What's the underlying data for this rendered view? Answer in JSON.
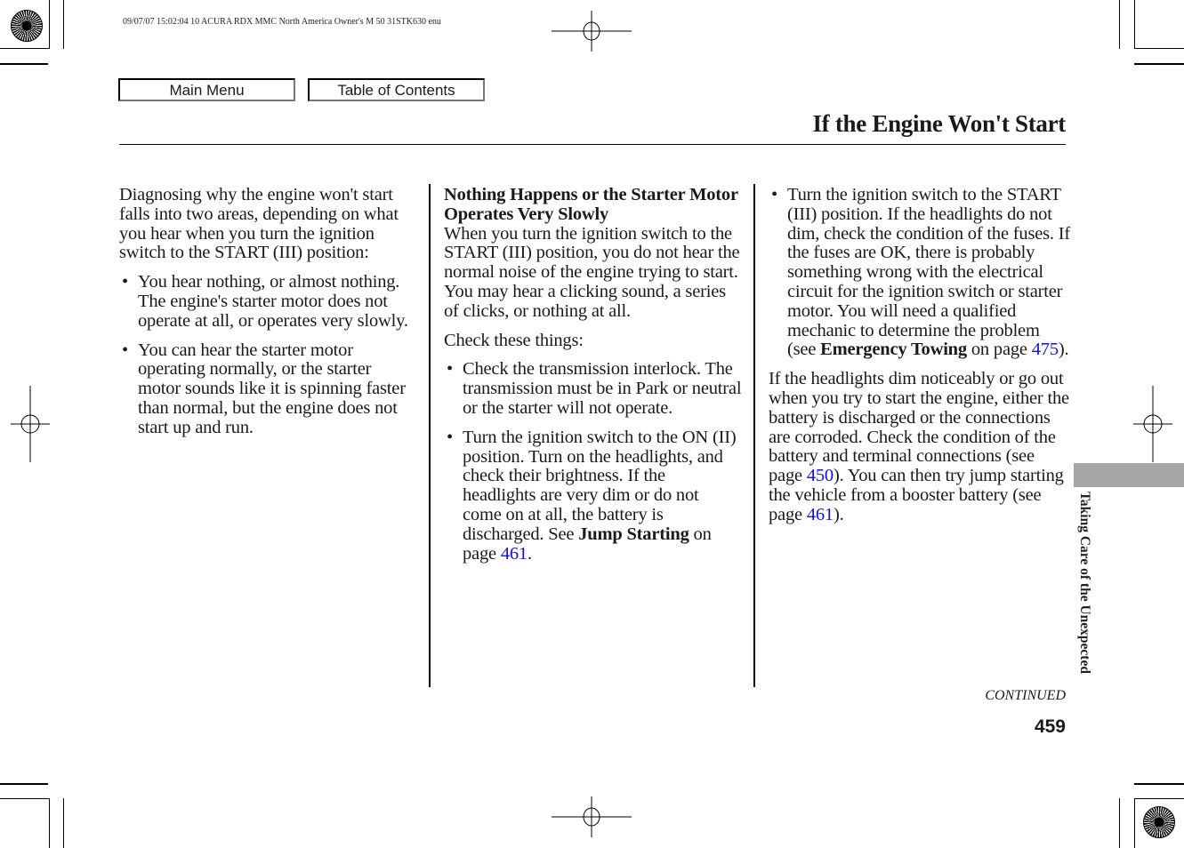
{
  "print_header": "09/07/07 15:02:04    10 ACURA RDX MMC North America Owner's M 50 31STK630 enu",
  "nav": {
    "main_menu": "Main Menu",
    "table_of_contents": "Table of Contents"
  },
  "page_title": "If the Engine Won't Start",
  "column1": {
    "intro": "Diagnosing why the engine won't start falls into two areas, depending on what you hear when you turn the ignition switch to the START (III) position:",
    "bullets": [
      "You hear nothing, or almost nothing. The engine's starter motor does not operate at all, or operates very slowly.",
      "You can hear the starter motor operating normally, or the starter motor sounds like it is spinning faster than normal, but the engine does not start up and run."
    ]
  },
  "column2": {
    "heading": "Nothing Happens or the Starter Motor Operates Very Slowly",
    "body": "When you turn the ignition switch to the START (III) position, you do not hear the normal noise of the engine trying to start. You may hear a clicking sound, a series of clicks, or nothing at all.",
    "check_label": "Check these things:",
    "bullet1": "Check the transmission interlock. The transmission must be in Park or neutral or the starter will not operate.",
    "bullet2_text": "Turn the ignition switch to the ON (II) position. Turn on the headlights, and check their brightness. If the headlights are very dim or do not come on at all, the battery is discharged. See",
    "bullet2_ref_bold": "Jump Starting",
    "bullet2_ref_mid": " on page ",
    "bullet2_ref_page": "461",
    "bullet2_ref_end": "."
  },
  "column3": {
    "bullet_text": "Turn the ignition switch to the START (III) position. If the headlights do not dim, check the condition of the fuses. If the fuses are OK, there is probably something wrong with the electrical circuit for the ignition switch or starter motor. You will need a qualified mechanic to determine the problem (see",
    "bullet_ref_bold": "Emergency Towing",
    "bullet_ref_mid": " on page ",
    "bullet_ref_page": "475",
    "bullet_ref_end": ").",
    "para_text1": "If the headlights dim noticeably or go out when you try to start the engine, either the battery is discharged or the connections are corroded. Check the condition of the battery and terminal connections (see page ",
    "para_page1": "450",
    "para_text2": "). You can then try jump starting the vehicle from a booster battery (see page ",
    "para_page2": "461",
    "para_text3": ")."
  },
  "section_label": "Taking Care of the Unexpected",
  "continued": "CONTINUED",
  "page_number": "459",
  "colors": {
    "link": "#1010e0",
    "section_tab": "#a6a6a6"
  }
}
